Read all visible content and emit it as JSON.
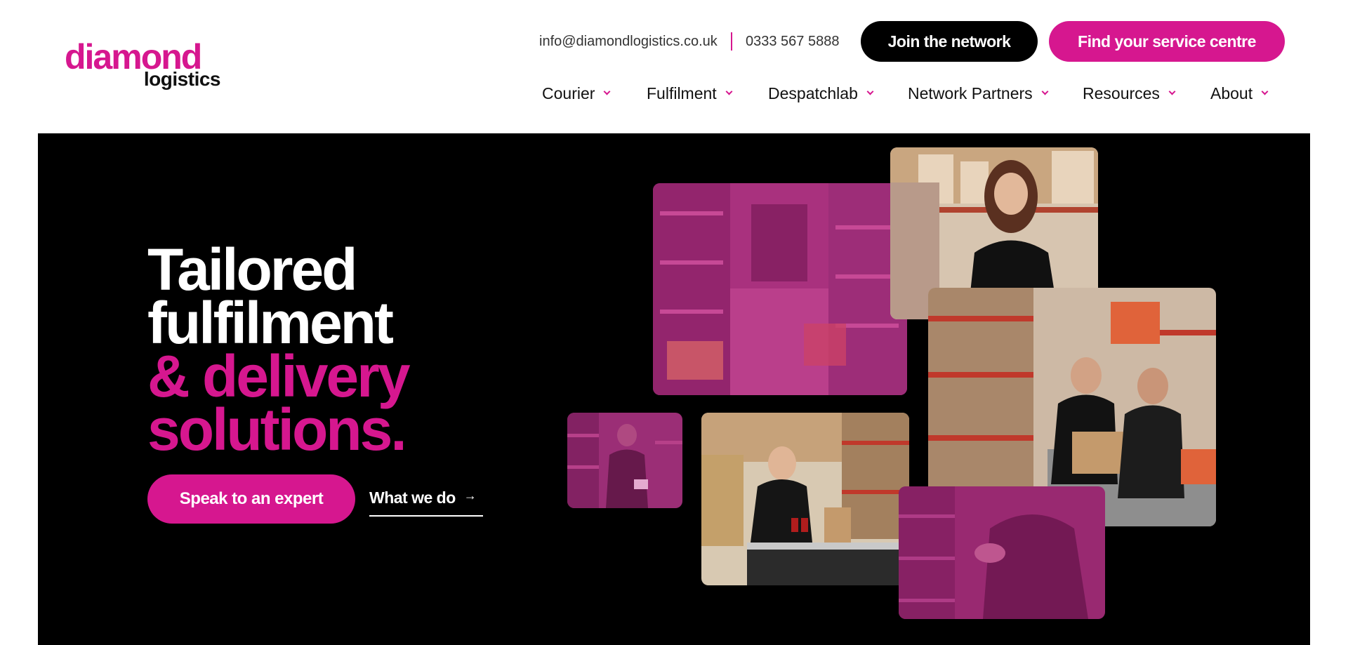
{
  "logo": {
    "top": "diamond",
    "bottom": "logistics"
  },
  "contact": {
    "email": "info@diamondlogistics.co.uk",
    "phone": "0333 567 5888"
  },
  "buttons": {
    "join": "Join the network",
    "find": "Find your service centre"
  },
  "nav": [
    {
      "label": "Courier"
    },
    {
      "label": "Fulfilment"
    },
    {
      "label": "Despatchlab"
    },
    {
      "label": "Network Partners"
    },
    {
      "label": "Resources"
    },
    {
      "label": "About"
    }
  ],
  "hero": {
    "headline": {
      "line1": "Tailored",
      "line2": "fulfilment",
      "line3": "& delivery",
      "line4": "solutions."
    },
    "cta_primary": "Speak to an expert",
    "cta_secondary": "What we do",
    "cta_secondary_arrow": "→"
  },
  "colors": {
    "brand_pink": "#d6178f",
    "black": "#000000",
    "white": "#ffffff"
  },
  "icons": [
    "chevron-down-icon",
    "arrow-right-icon"
  ]
}
